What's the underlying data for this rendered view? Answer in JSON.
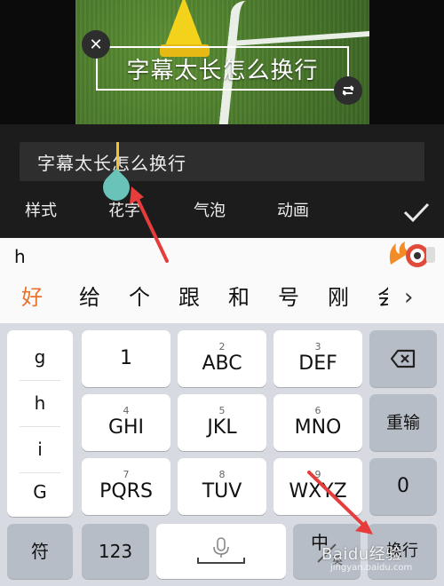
{
  "preview": {
    "subtitle_text": "字幕太长怎么换行",
    "close_icon_glyph": "✕",
    "rotate_icon_glyph": "⟳"
  },
  "editor": {
    "text_value_before": "字幕太长",
    "text_value_after": "怎么换行",
    "tabs": [
      "样式",
      "花字",
      "气泡",
      "动画"
    ],
    "confirm_icon": "checkmark-icon"
  },
  "keyboard": {
    "typed": "h",
    "candidates": [
      "好",
      "给",
      "个",
      "跟",
      "和",
      "号",
      "刚",
      "会"
    ],
    "more_glyph": "›",
    "side_letters": [
      "g",
      "h",
      "i",
      "G"
    ],
    "keys": [
      {
        "num": "",
        "label": "1"
      },
      {
        "num": "2",
        "label": "ABC"
      },
      {
        "num": "3",
        "label": "DEF"
      },
      {
        "num": "4",
        "label": "GHI"
      },
      {
        "num": "5",
        "label": "JKL"
      },
      {
        "num": "6",
        "label": "MNO"
      },
      {
        "num": "7",
        "label": "PQRS"
      },
      {
        "num": "8",
        "label": "TUV"
      },
      {
        "num": "9",
        "label": "WXYZ"
      }
    ],
    "backspace_icon": "backspace-icon",
    "reinput_label": "重输",
    "zero_label": "0",
    "symbol_label": "符",
    "num_label": "123",
    "mic_icon": "microphone-icon",
    "lang_label_main": "中",
    "lang_label_sub": "英",
    "enter_label": "换行"
  },
  "watermark": {
    "text": "Baidu经验",
    "sub": "jingyan.baidu.com"
  },
  "colors": {
    "accent_orange": "#e8722e",
    "cursor_yellow": "#f2c230",
    "handle_teal": "#69c3b9",
    "arrow_red": "#e63c3c"
  }
}
